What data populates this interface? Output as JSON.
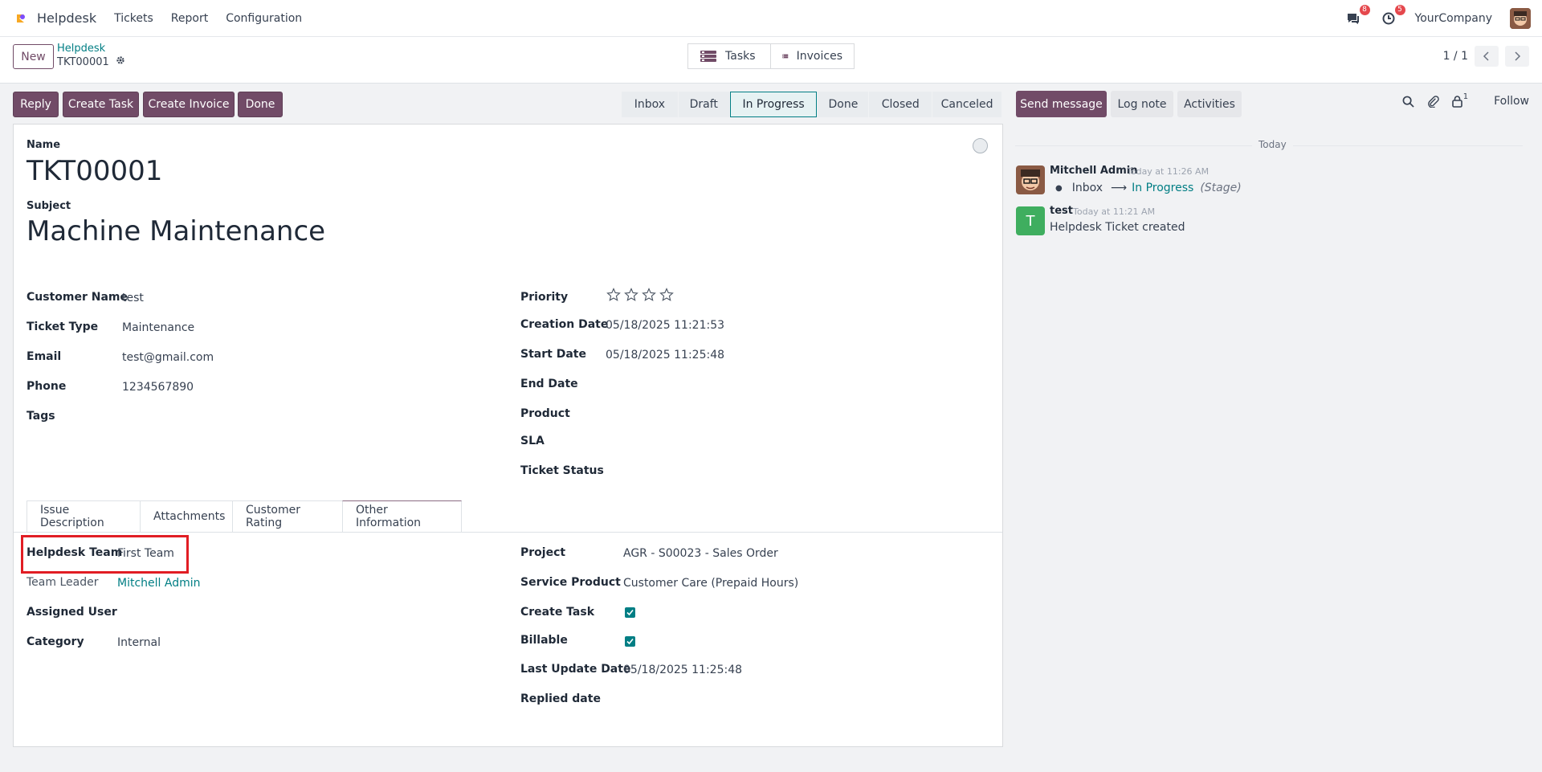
{
  "topnav": {
    "app_name": "Helpdesk",
    "menu": [
      "Tickets",
      "Report",
      "Configuration"
    ],
    "messages_count": "8",
    "activities_count": "5",
    "company": "YourCompany"
  },
  "control": {
    "new_label": "New",
    "breadcrumb_parent": "Helpdesk",
    "breadcrumb_current": "TKT00001",
    "smart_buttons": [
      "Tasks",
      "Invoices"
    ],
    "pager": "1 / 1"
  },
  "actions": [
    "Reply",
    "Create Task",
    "Create Invoice",
    "Done"
  ],
  "stages": [
    "Inbox",
    "Draft",
    "In Progress",
    "Done",
    "Closed",
    "Canceled"
  ],
  "active_stage": "In Progress",
  "form": {
    "name_label": "Name",
    "name": "TKT00001",
    "subject_label": "Subject",
    "subject": "Machine Maintenance",
    "left_fields": [
      {
        "label": "Customer Name",
        "value": "test"
      },
      {
        "label": "Ticket Type",
        "value": "Maintenance"
      },
      {
        "label": "Email",
        "value": "test@gmail.com"
      },
      {
        "label": "Phone",
        "value": "1234567890"
      },
      {
        "label": "Tags",
        "value": ""
      }
    ],
    "right_fields": [
      {
        "label": "Priority",
        "value": ""
      },
      {
        "label": "Creation Date",
        "value": "05/18/2025 11:21:53"
      },
      {
        "label": "Start Date",
        "value": "05/18/2025 11:25:48"
      },
      {
        "label": "End Date",
        "value": ""
      },
      {
        "label": "Product",
        "value": ""
      },
      {
        "label": "SLA",
        "value": ""
      },
      {
        "label": "Ticket Status",
        "value": ""
      }
    ],
    "priority_stars": 0,
    "tabs": [
      "Issue Description",
      "Attachments",
      "Customer Rating",
      "Other Information"
    ],
    "active_tab": "Other Information",
    "other_left": [
      {
        "label": "Helpdesk Team",
        "value": "First Team"
      },
      {
        "label": "Team Leader",
        "value": "Mitchell Admin"
      },
      {
        "label": "Assigned User",
        "value": ""
      },
      {
        "label": "Category",
        "value": "Internal"
      }
    ],
    "other_right": [
      {
        "label": "Project",
        "value": "AGR - S00023 - Sales Order"
      },
      {
        "label": "Service Product",
        "value": "Customer Care (Prepaid Hours)"
      },
      {
        "label": "Create Task",
        "value": "checked"
      },
      {
        "label": "Billable",
        "value": "checked"
      },
      {
        "label": "Last Update Date",
        "value": "05/18/2025 11:25:48"
      },
      {
        "label": "Replied date",
        "value": ""
      }
    ]
  },
  "chatter": {
    "send_message": "Send message",
    "log_note": "Log note",
    "activities": "Activities",
    "followers_count": "1",
    "follow": "Follow",
    "day_separator": "Today",
    "messages": [
      {
        "author": "Mitchell Admin",
        "time": "Today at 11:26 AM",
        "from": "Inbox",
        "to": "In Progress",
        "field": "(Stage)"
      },
      {
        "author": "test",
        "time": "Today at 11:21 AM",
        "body": "Helpdesk Ticket created",
        "initial": "T"
      }
    ]
  },
  "colors": {
    "brand": "#714b67",
    "link": "#017e84",
    "highlight": "#e11d24"
  }
}
